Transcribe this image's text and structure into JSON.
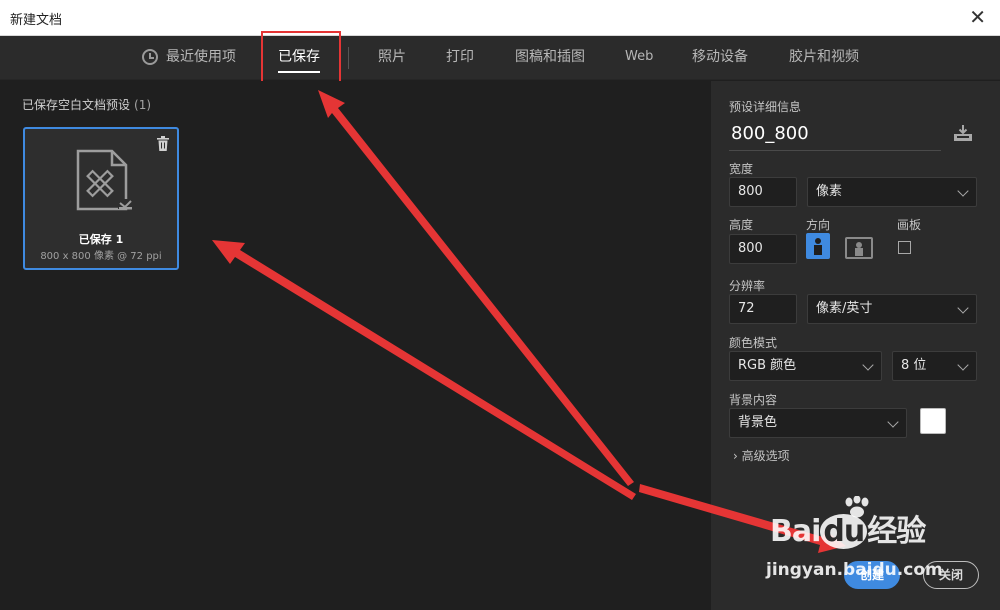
{
  "window": {
    "title": "新建文档",
    "close_glyph": "✕"
  },
  "tabs": [
    {
      "label": "最近使用项",
      "icon": "clock-icon",
      "active": false
    },
    {
      "label": "已保存",
      "active": true
    },
    {
      "label": "照片",
      "active": false
    },
    {
      "label": "打印",
      "active": false
    },
    {
      "label": "图稿和插图",
      "active": false
    },
    {
      "label": "Web",
      "active": false
    },
    {
      "label": "移动设备",
      "active": false
    },
    {
      "label": "胶片和视频",
      "active": false
    }
  ],
  "saved": {
    "section_title": "已保存空白文档预设",
    "count": "(1)",
    "presets": [
      {
        "name": "已保存 1",
        "meta": "800 x 800 像素 @ 72 ppi",
        "icon": "document-tools-icon",
        "selected": true
      }
    ]
  },
  "details": {
    "heading": "预设详细信息",
    "preset_name": "800_800",
    "width_label": "宽度",
    "width_value": "800",
    "width_unit": "像素",
    "height_label": "高度",
    "height_value": "800",
    "orientation_label": "方向",
    "orientation_selected": "portrait",
    "artboard_label": "画板",
    "artboard_checked": false,
    "resolution_label": "分辨率",
    "resolution_value": "72",
    "resolution_unit": "像素/英寸",
    "color_mode_label": "颜色模式",
    "color_mode_value": "RGB 颜色",
    "bit_depth_value": "8 位",
    "background_label": "背景内容",
    "background_value": "背景色",
    "background_swatch": "#ffffff",
    "advanced_label": "高级选项"
  },
  "buttons": {
    "create": "创建",
    "close": "关闭"
  },
  "watermark": {
    "logo_bai": "Bai",
    "logo_du": "du",
    "logo_cn": "经验",
    "url": "jingyan.baidu.com"
  },
  "colors": {
    "accent": "#3f8ae0",
    "annotation": "#e53535",
    "panel": "#2b2b2b",
    "canvas": "#1f1f1f"
  }
}
